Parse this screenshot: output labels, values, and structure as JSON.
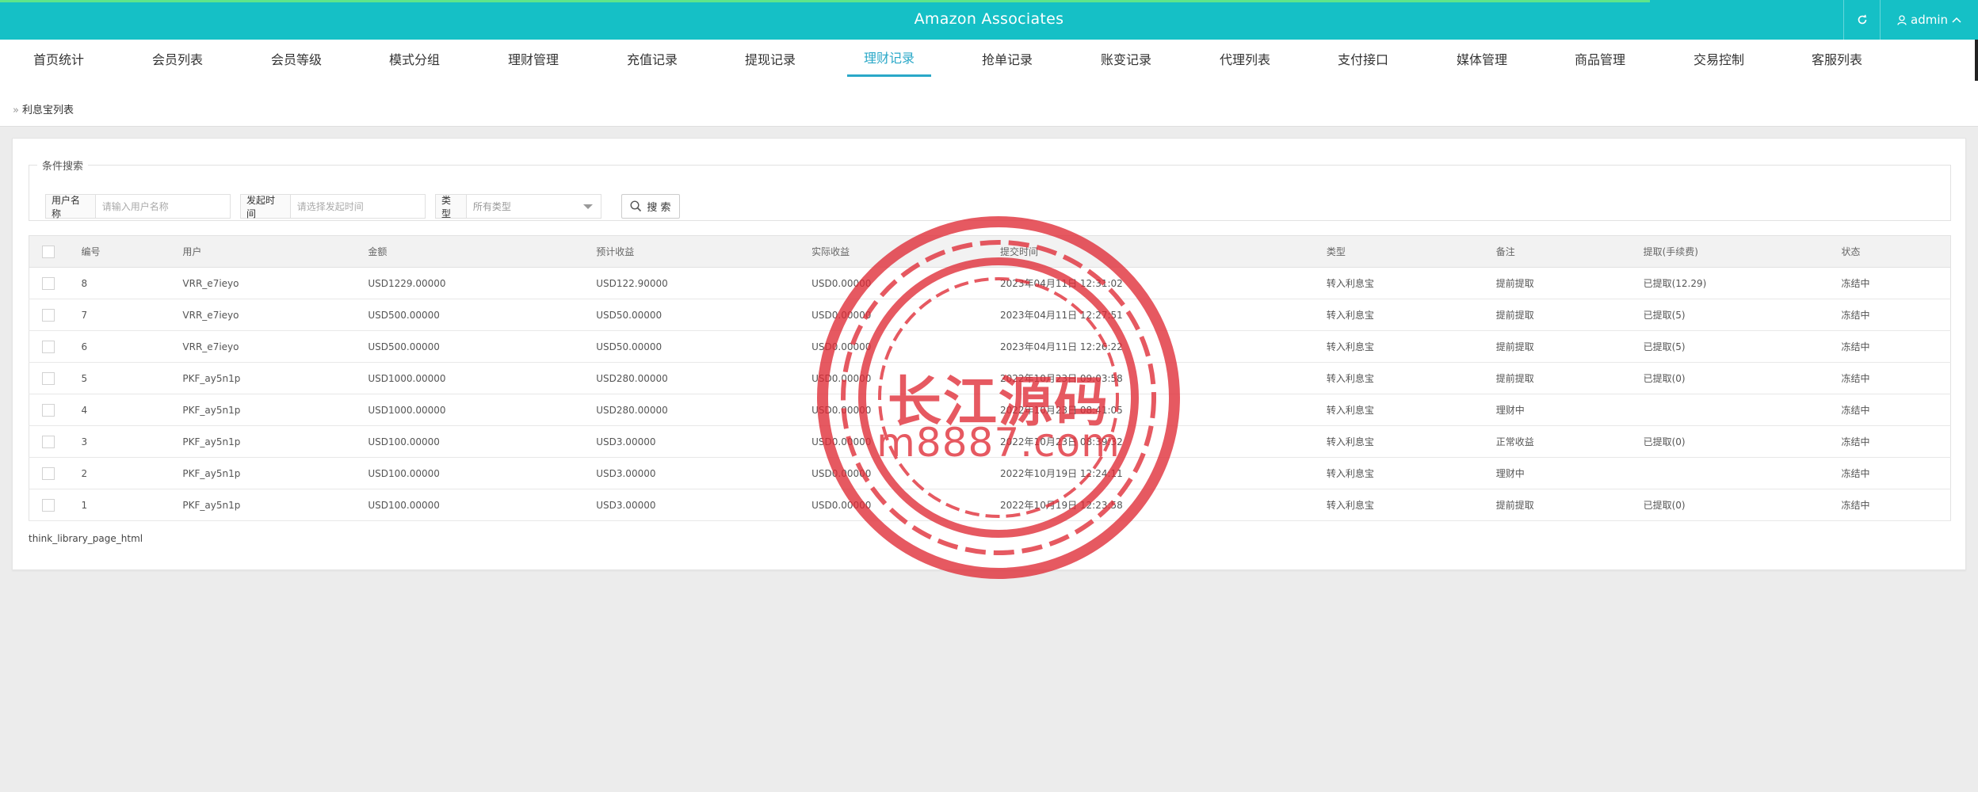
{
  "header": {
    "title": "Amazon Associates",
    "user": "admin"
  },
  "nav": {
    "items": [
      "首页统计",
      "会员列表",
      "会员等级",
      "模式分组",
      "理财管理",
      "充值记录",
      "提现记录",
      "理财记录",
      "抢单记录",
      "账变记录",
      "代理列表",
      "支付接口",
      "媒体管理",
      "商品管理",
      "交易控制",
      "客服列表"
    ],
    "active_index": 7
  },
  "breadcrumb": {
    "current": "利息宝列表"
  },
  "search": {
    "legend": "条件搜索",
    "username_label": "用户名称",
    "username_placeholder": "请输入用户名称",
    "time_label": "发起时间",
    "time_placeholder": "请选择发起时间",
    "type_label": "类型",
    "type_value": "所有类型",
    "button_label": "搜 索"
  },
  "table": {
    "headers": [
      "编号",
      "用户",
      "金额",
      "预计收益",
      "实际收益",
      "提交时间",
      "类型",
      "备注",
      "提取(手续费)",
      "状态"
    ],
    "rows": [
      [
        "8",
        "VRR_e7ieyo",
        "USD1229.00000",
        "USD122.90000",
        "USD0.00000",
        "2023年04月11日 12:31:02",
        "转入利息宝",
        "提前提取",
        "已提取(12.29)",
        "冻结中"
      ],
      [
        "7",
        "VRR_e7ieyo",
        "USD500.00000",
        "USD50.00000",
        "USD0.00000",
        "2023年04月11日 12:27:51",
        "转入利息宝",
        "提前提取",
        "已提取(5)",
        "冻结中"
      ],
      [
        "6",
        "VRR_e7ieyo",
        "USD500.00000",
        "USD50.00000",
        "USD0.00000",
        "2023年04月11日 12:26:22",
        "转入利息宝",
        "提前提取",
        "已提取(5)",
        "冻结中"
      ],
      [
        "5",
        "PKF_ay5n1p",
        "USD1000.00000",
        "USD280.00000",
        "USD0.00000",
        "2022年10月23日 09:03:58",
        "转入利息宝",
        "提前提取",
        "已提取(0)",
        "冻结中"
      ],
      [
        "4",
        "PKF_ay5n1p",
        "USD1000.00000",
        "USD280.00000",
        "USD0.00000",
        "2022年10月23日 08:41:05",
        "转入利息宝",
        "理财中",
        "",
        "冻结中"
      ],
      [
        "3",
        "PKF_ay5n1p",
        "USD100.00000",
        "USD3.00000",
        "USD0.00000",
        "2022年10月23日 08:39:32",
        "转入利息宝",
        "正常收益",
        "已提取(0)",
        "冻结中"
      ],
      [
        "2",
        "PKF_ay5n1p",
        "USD100.00000",
        "USD3.00000",
        "USD0.00000",
        "2022年10月19日 12:24:11",
        "转入利息宝",
        "理财中",
        "",
        "冻结中"
      ],
      [
        "1",
        "PKF_ay5n1p",
        "USD100.00000",
        "USD3.00000",
        "USD0.00000",
        "2022年10月19日 12:23:58",
        "转入利息宝",
        "提前提取",
        "已提取(0)",
        "冻结中"
      ]
    ]
  },
  "pager": {
    "text": "think_library_page_html"
  },
  "watermark": {
    "line1": "长江源码",
    "line2": "m8887.com"
  },
  "colors": {
    "topbar": "#15c0c6",
    "accent": "#2aa8c8",
    "watermark": "#e02b36"
  }
}
